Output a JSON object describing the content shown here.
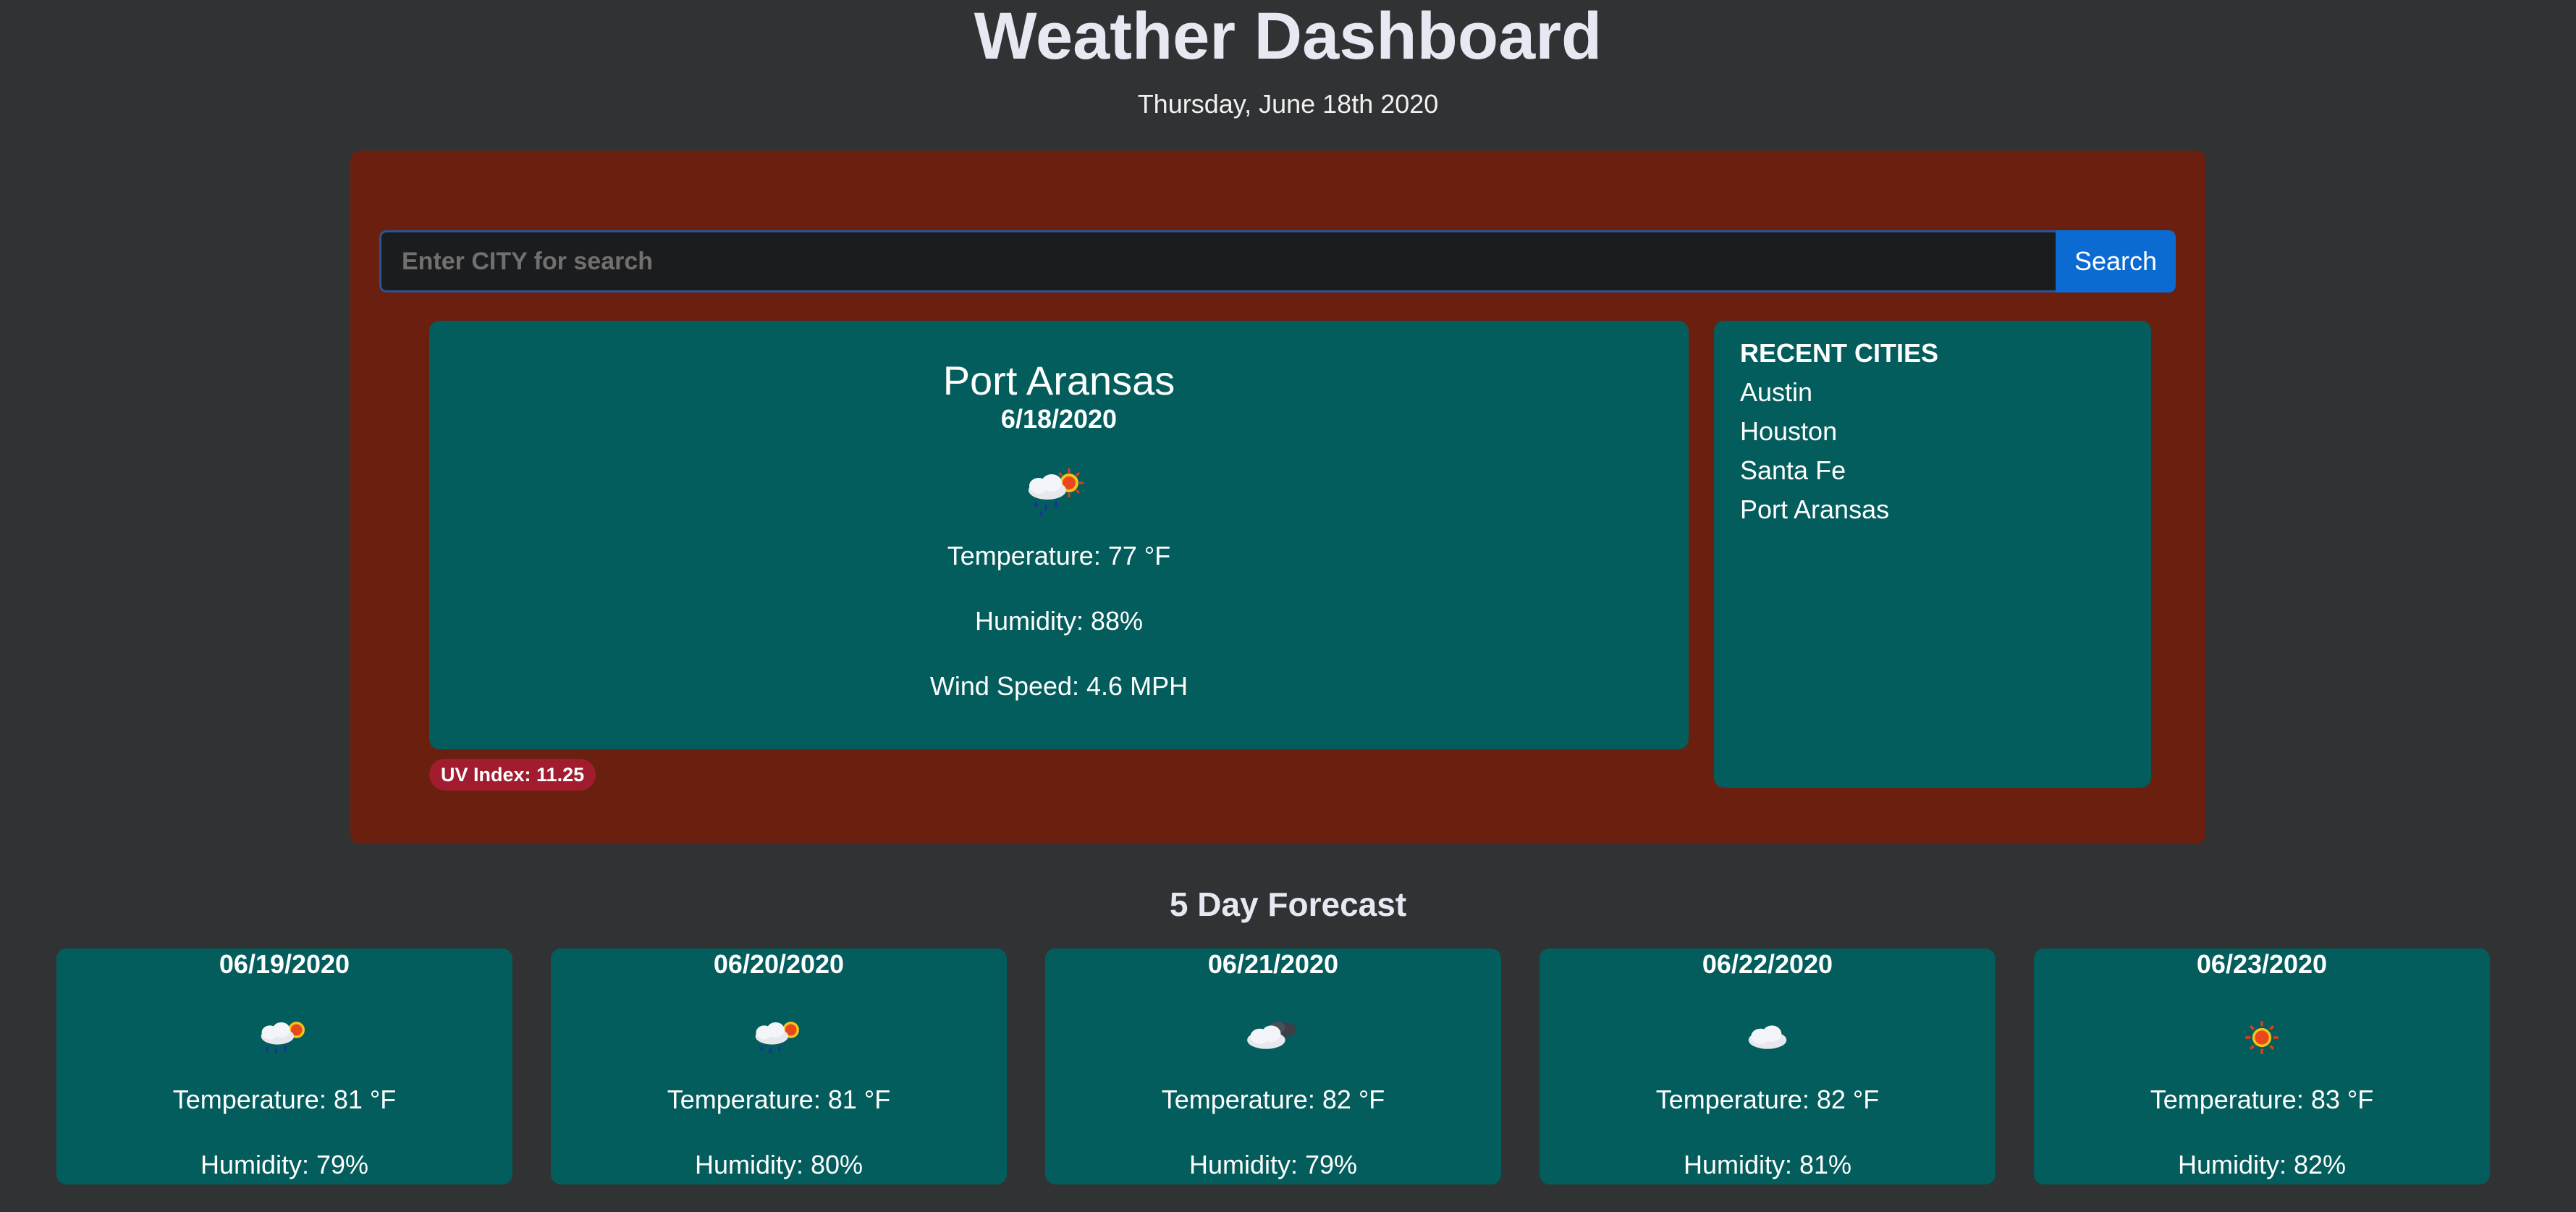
{
  "header": {
    "title": "Weather Dashboard",
    "date": "Thursday, June 18th 2020"
  },
  "search": {
    "placeholder": "Enter CITY for search",
    "button_label": "Search"
  },
  "current": {
    "city": "Port Aransas",
    "date": "6/18/2020",
    "icon": "rain-sun-icon",
    "temperature": "Temperature: 77 °F",
    "humidity": "Humidity: 88%",
    "wind": "Wind Speed: 4.6 MPH",
    "uv_index": "UV Index: 11.25",
    "uv_color": "#a11c2e"
  },
  "recent": {
    "title": "RECENT CITIES",
    "cities": [
      "Austin",
      "Houston",
      "Santa Fe",
      "Port Aransas"
    ]
  },
  "forecast": {
    "title": "5 Day Forecast",
    "days": [
      {
        "date": "06/19/2020",
        "icon": "rain-sun-icon",
        "temperature": "Temperature: 81 °F",
        "humidity": "Humidity: 79%"
      },
      {
        "date": "06/20/2020",
        "icon": "rain-sun-icon",
        "temperature": "Temperature: 81 °F",
        "humidity": "Humidity: 80%"
      },
      {
        "date": "06/21/2020",
        "icon": "cloud-night-icon",
        "temperature": "Temperature: 82 °F",
        "humidity": "Humidity: 79%"
      },
      {
        "date": "06/22/2020",
        "icon": "cloud-icon",
        "temperature": "Temperature: 82 °F",
        "humidity": "Humidity: 81%"
      },
      {
        "date": "06/23/2020",
        "icon": "sun-icon",
        "temperature": "Temperature: 83 °F",
        "humidity": "Humidity: 82%"
      }
    ]
  },
  "colors": {
    "background": "#313234",
    "panel": "#6b1f0e",
    "card": "#035d5c",
    "button": "#0b6bd2"
  }
}
